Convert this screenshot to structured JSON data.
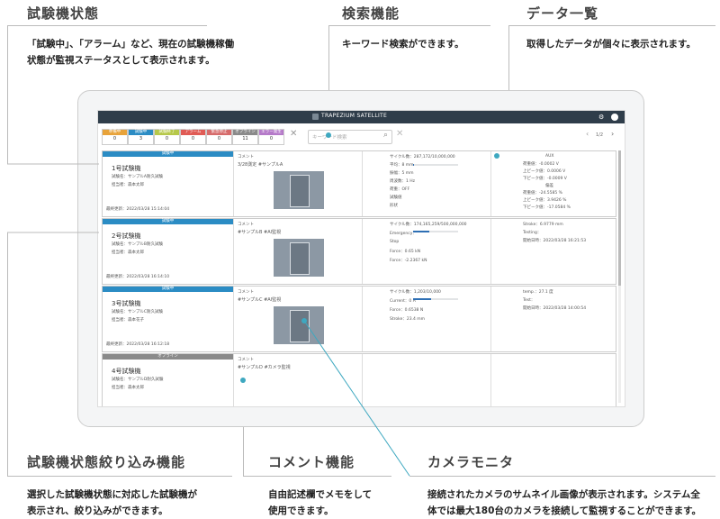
{
  "annotations": {
    "status": {
      "title": "試験機状態",
      "desc1": "「試験中」、「アラーム」など、現在の試験機稼働",
      "desc2": "状態が監視ステータスとして表示されます。"
    },
    "search": {
      "title": "検索機能",
      "desc1": "キーワード検索ができます。"
    },
    "data_list": {
      "title": "データ一覧",
      "desc1": "取得したデータが個々に表示されます。"
    },
    "filter": {
      "title": "試験機状態絞り込み機能",
      "desc1": "選択した試験機状態に対応した試験機が",
      "desc2": "表示され、絞り込みができます。"
    },
    "comment": {
      "title": "コメント機能",
      "desc1": "自由記述欄でメモをして",
      "desc2": "使用できます。"
    },
    "camera": {
      "title": "カメラモニタ",
      "desc1": "接続されたカメラのサムネイル画像が表示されます。システム全",
      "desc2": "体では最大180台のカメラを接続して監視することができます。"
    }
  },
  "app": {
    "title": "TRAPEZIUM SATELLITE",
    "page": "1/2",
    "search_placeholder": "キーワード検索",
    "colors": {
      "topbar": "#2f3d4a",
      "testing": "#2b8cc4",
      "offline": "#8a8a8a",
      "accent": "#3ea8c0"
    },
    "chips": [
      {
        "label": "準備中",
        "count": "0",
        "color": "#e8a33a"
      },
      {
        "label": "試験中",
        "count": "3",
        "color": "#2b8cc4"
      },
      {
        "label": "試験終了",
        "count": "0",
        "color": "#b6c84a"
      },
      {
        "label": "アラーム",
        "count": "0",
        "color": "#e05b55"
      },
      {
        "label": "緊急停止",
        "count": "0",
        "color": "#d66b6b"
      },
      {
        "label": "オフライン",
        "count": "11",
        "color": "#8a8a8a"
      },
      {
        "label": "エラー発生",
        "count": "0",
        "color": "#b57ac9"
      }
    ]
  },
  "machines": [
    {
      "status": "試験中",
      "name": "1号試験機",
      "test": "試験名：サンプルA耐久試験",
      "person": "担当者：森本太郎",
      "updated": "最終更新：2022/03/28 15:14:04",
      "comment_label": "コメント",
      "comment": "3/28測定 #サンプルA",
      "data": [
        "サイクル数：287,172/10,000,000",
        "平均：8 mm",
        "振幅：5 mm",
        "周波数：1 Hz",
        "荷重：OFF",
        "試験値",
        "形状"
      ],
      "aux": [
        "AUX",
        "荷重値：-0.0002 V",
        "上ピーク値：0.0006 V",
        "下ピーク値：-0.0009 V",
        "偏差",
        "荷重値：-24.5585 %",
        "上ピーク値：3.9426 %",
        "下ピーク値：-17.0584 %"
      ]
    },
    {
      "status": "試験中",
      "name": "2号試験機",
      "test": "試験名：サンプルB耐久試験",
      "person": "担当者：森本太郎",
      "updated": "最終更新：2022/03/28 16:14:10",
      "comment_label": "コメント",
      "comment": "#サンプルB #AI監視",
      "data": [
        "サイクル数：174,165,259/500,000,000",
        "Emergency：",
        "Stop",
        "Force：0.65 kN",
        "Force：-2.2367 kN"
      ],
      "aux": [
        "Stroke：6.9779 mm",
        "Testing：",
        "開始日時：2022/03/28 16:21:53"
      ]
    },
    {
      "status": "試験中",
      "name": "3号試験機",
      "test": "試験名：サンプルC耐久試験",
      "person": "担当者：森本花子",
      "updated": "最終更新：2022/03/28 16:12:18",
      "comment_label": "コメント",
      "comment": "#サンプルC #AI監視",
      "data": [
        "サイクル数：1,203/10,000",
        "Current：0 A",
        "Force：0.6538 N",
        "Stroke：23.4 mm"
      ],
      "aux": [
        "temp.：27.1 度",
        "Test：",
        "開始日時：2022/03/28 14:00:54"
      ]
    },
    {
      "status": "オフライン",
      "name": "4号試験機",
      "test": "試験名：サンプルD耐久試験",
      "person": "担当者：森本太郎",
      "updated": "",
      "comment_label": "コメント",
      "comment": "#サンプルD #カメラ監視",
      "data": [],
      "aux": []
    }
  ]
}
